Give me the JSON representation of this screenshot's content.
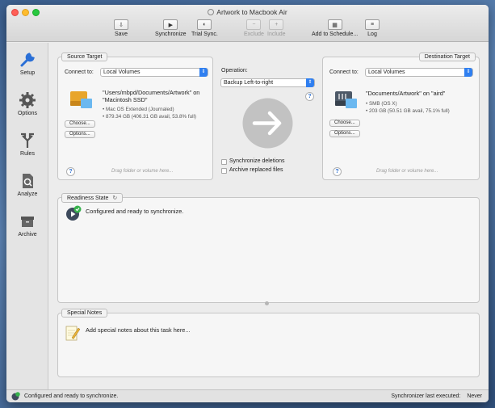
{
  "window": {
    "title": "Artwork to Macbook Air"
  },
  "toolbar": {
    "save": "Save",
    "synchronize": "Synchronize",
    "trial_sync": "Trial Sync.",
    "exclude": "Exclude",
    "include": "Include",
    "add_to_schedule": "Add to Schedule...",
    "log": "Log"
  },
  "sidebar": {
    "items": [
      {
        "label": "Setup",
        "icon": "wrench-icon",
        "selected": true
      },
      {
        "label": "Options",
        "icon": "gear-icon"
      },
      {
        "label": "Rules",
        "icon": "fork-icon"
      },
      {
        "label": "Analyze",
        "icon": "analyze-icon"
      },
      {
        "label": "Archive",
        "icon": "archive-icon"
      }
    ]
  },
  "source": {
    "tab": "Source Target",
    "connect_label": "Connect to:",
    "connect_value": "Local Volumes",
    "path_line1": "\"Users/mbpd/Documents/Artwork\" on",
    "path_line2": "\"Macintosh SSD\"",
    "format": "• Mac OS Extended (Journaled)",
    "capacity": "• 879.34 GB (406.31 GB avail, 53.8% full)",
    "choose": "Choose...",
    "options": "Options...",
    "drag_hint": "Drag folder or volume here...",
    "help": "?"
  },
  "operation": {
    "label": "Operation:",
    "value": "Backup Left-to-right",
    "help": "?",
    "sync_deletions": "Synchronize deletions",
    "archive_replaced": "Archive replaced files"
  },
  "destination": {
    "tab": "Destination Target",
    "connect_label": "Connect to:",
    "connect_value": "Local Volumes",
    "path_line1": "\"Documents/Artwork\" on \"aird\"",
    "format": "• SMB (OS X)",
    "capacity": "• 203 GB (50.51 GB avail, 75.1% full)",
    "choose": "Choose...",
    "options": "Options...",
    "drag_hint": "Drag folder or volume here...",
    "help": "?"
  },
  "readiness": {
    "tab": "Readiness State",
    "message": "Configured and ready to synchronize."
  },
  "notes": {
    "tab": "Special Notes",
    "placeholder": "Add special notes about this task here..."
  },
  "status": {
    "message": "Configured and ready to synchronize.",
    "last_executed_label": "Synchronizer last executed:",
    "last_executed_value": "Never"
  },
  "colors": {
    "accent": "#2f7ff0",
    "sidebar_selected": "#2a6fd6",
    "ready_green": "#37b24d"
  }
}
